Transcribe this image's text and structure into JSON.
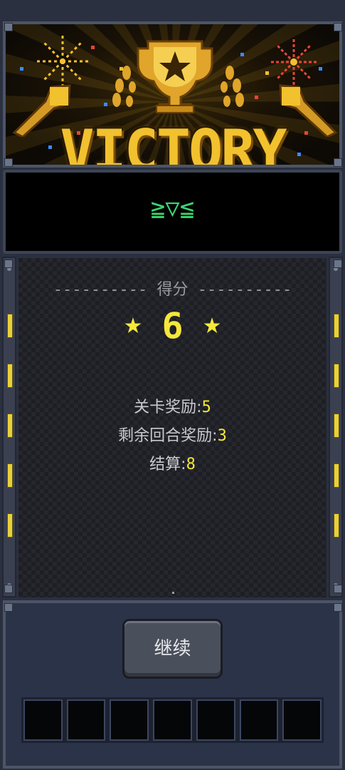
{
  "banner": {
    "title": "VICTORY",
    "decor_icons": [
      "trophy-icon",
      "trumpet-icon",
      "laurel-icon",
      "firework-icon",
      "confetti-icon"
    ],
    "colors": {
      "gold": "#f2c12e",
      "background": "#1a1206"
    }
  },
  "emote": {
    "text": "≧▽≦",
    "color": "#3bd46d"
  },
  "score": {
    "header": "---------- 得分 ----------",
    "value": "6",
    "star_left": "★",
    "star_right": "★",
    "details": [
      {
        "label": "关卡奖励:",
        "value": "5"
      },
      {
        "label": "剩余回合奖励:",
        "value": "3"
      },
      {
        "label": "结算:",
        "value": "8"
      }
    ],
    "accent_color": "#f5e83a"
  },
  "actions": {
    "continue_label": "继续"
  },
  "inventory": {
    "slot_count": 7
  }
}
